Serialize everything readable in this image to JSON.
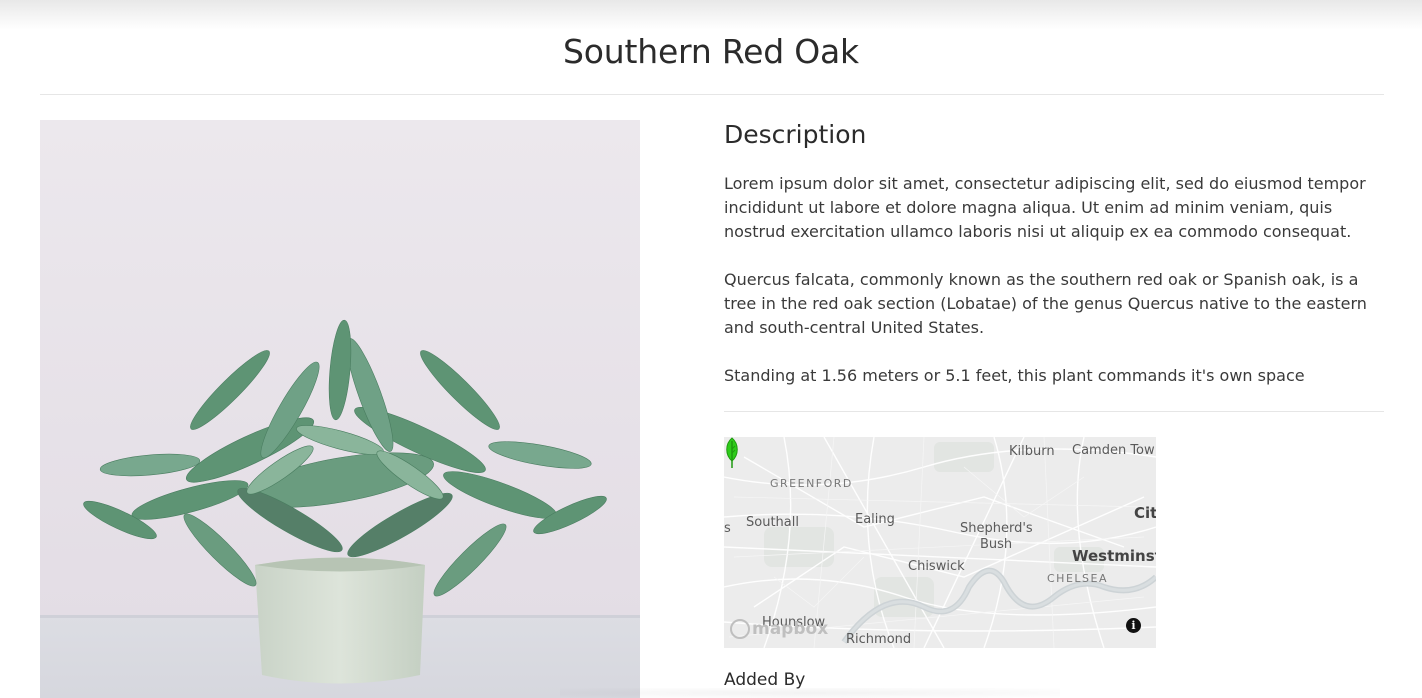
{
  "page": {
    "title": "Southern Red Oak"
  },
  "plant_image": {
    "icon": "plant-photo",
    "alt": ""
  },
  "description": {
    "heading": "Description",
    "paragraphs": [
      "Lorem ipsum dolor sit amet, consectetur adipiscing elit, sed do eiusmod tempor incididunt ut labore et dolore magna aliqua. Ut enim ad minim veniam, quis nostrud exercitation ullamco laboris nisi ut aliquip ex ea commodo consequat.",
      "Quercus falcata, commonly known as the southern red oak or Spanish oak, is a tree in the red oak section (Lobatae) of the genus Quercus native to the eastern and south-central United States.",
      "Standing at 1.56 meters or 5.1 feet, this plant commands it's own space"
    ]
  },
  "map": {
    "labels": {
      "kilburn": "Kilburn",
      "camden": "Camden Tow",
      "greenford": "GREENFORD",
      "southall": "Southall",
      "s": "s",
      "ealing": "Ealing",
      "shepherds": "Shepherd's",
      "bush": "Bush",
      "city": "Cit",
      "westminster": "Westminst",
      "chiswick": "Chiswick",
      "chelsea": "CHELSEA",
      "hounslow": "Hounslow",
      "richmond": "Richmond"
    },
    "attribution": "mapbox",
    "info_glyph": "i",
    "marker_color": "#2ecc1a"
  },
  "added_by": {
    "label": "Added By"
  }
}
